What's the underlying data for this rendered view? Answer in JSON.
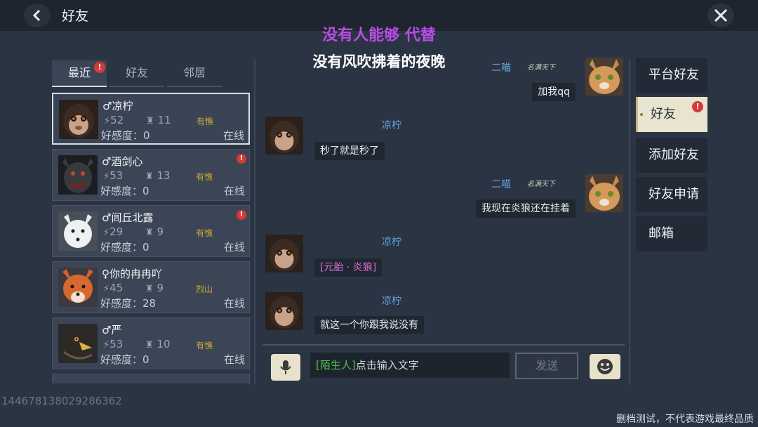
{
  "header": {
    "title": "好友"
  },
  "overlay": {
    "line1": "没有人能够 代替",
    "line2": "没有风吹拂着的夜晚"
  },
  "tabs": [
    {
      "label": "最近",
      "badge": "!"
    },
    {
      "label": "好友"
    },
    {
      "label": "邻居"
    }
  ],
  "friends": [
    {
      "name": "♂凉柠",
      "level": "52",
      "power": "11",
      "tag": "有憔",
      "favor": "好感度：0",
      "status": "在线",
      "alert": ""
    },
    {
      "name": "♂酒剑心",
      "level": "53",
      "power": "13",
      "tag": "有憔",
      "favor": "好感度：0",
      "status": "在线",
      "alert": "!"
    },
    {
      "name": "♂闾丘北露",
      "level": "29",
      "power": "9",
      "tag": "有憔",
      "favor": "好感度：0",
      "status": "在线",
      "alert": "!"
    },
    {
      "name": "♀你的冉冉吖",
      "level": "45",
      "power": "9",
      "tag": "烈山",
      "favor": "好感度：28",
      "status": "在线",
      "alert": ""
    },
    {
      "name": "♂严",
      "level": "53",
      "power": "10",
      "tag": "有憔",
      "favor": "好感度：0",
      "status": "在线",
      "alert": ""
    }
  ],
  "chat": {
    "messages": [
      {
        "sender": "二喵",
        "vip": "名满天下",
        "text": "加我qq"
      },
      {
        "sender": "凉柠",
        "text": "秒了就是秒了"
      },
      {
        "sender": "二喵",
        "vip": "名满天下",
        "text": "我现在炎狼还在挂着"
      },
      {
        "sender": "凉柠",
        "text": "[元胎 · 炎狼]"
      },
      {
        "sender": "凉柠",
        "text": "就这一个你跟我说没有"
      }
    ],
    "input_prefix": "[陌生人]",
    "input_placeholder": "点击输入文字",
    "send_label": "发送"
  },
  "nav": [
    {
      "label": "平台好友"
    },
    {
      "label": "好友",
      "badge": "!"
    },
    {
      "label": "添加好友"
    },
    {
      "label": "好友申请"
    },
    {
      "label": "邮箱"
    }
  ],
  "footer": {
    "id": "1446781380292863​62",
    "note": "删档测试，不代表游戏最终品质"
  },
  "colors": {
    "accent_name": "#5ea7df",
    "overlay_purple": "#b84ce6",
    "tag_gold": "#d4a938",
    "alert_red": "#d43a3a"
  }
}
